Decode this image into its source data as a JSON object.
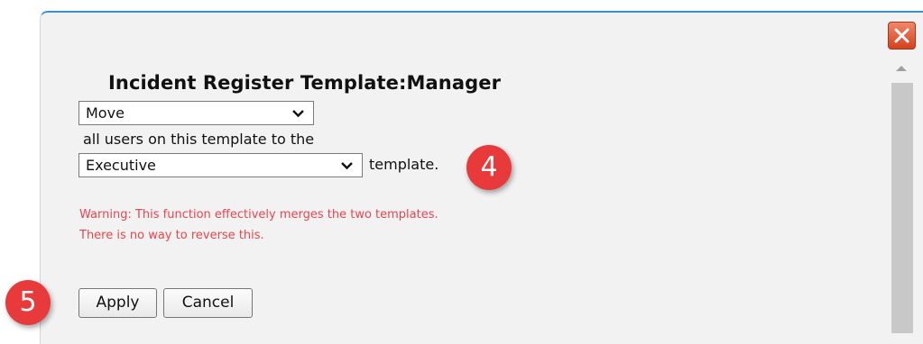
{
  "dialog": {
    "title": "Incident Register Template:Manager",
    "action_select": {
      "value": "Move"
    },
    "users_text": "all users on this template to the",
    "template_select": {
      "value": "Executive"
    },
    "template_suffix": "template.",
    "warning_line1": "Warning: This function effectively merges the two templates.",
    "warning_line2": "There is no way to reverse this.",
    "apply_label": "Apply",
    "cancel_label": "Cancel"
  },
  "annotations": {
    "step4": "4",
    "step5": "5"
  },
  "icons": {
    "close": "close-icon",
    "scroll_up": "scroll-up-arrow-icon",
    "dropdown": "chevron-down-icon"
  },
  "colors": {
    "accent": "#3c8fd6",
    "warning": "#e8454f",
    "badge": "#e83a3a",
    "close": "#d4401f"
  }
}
